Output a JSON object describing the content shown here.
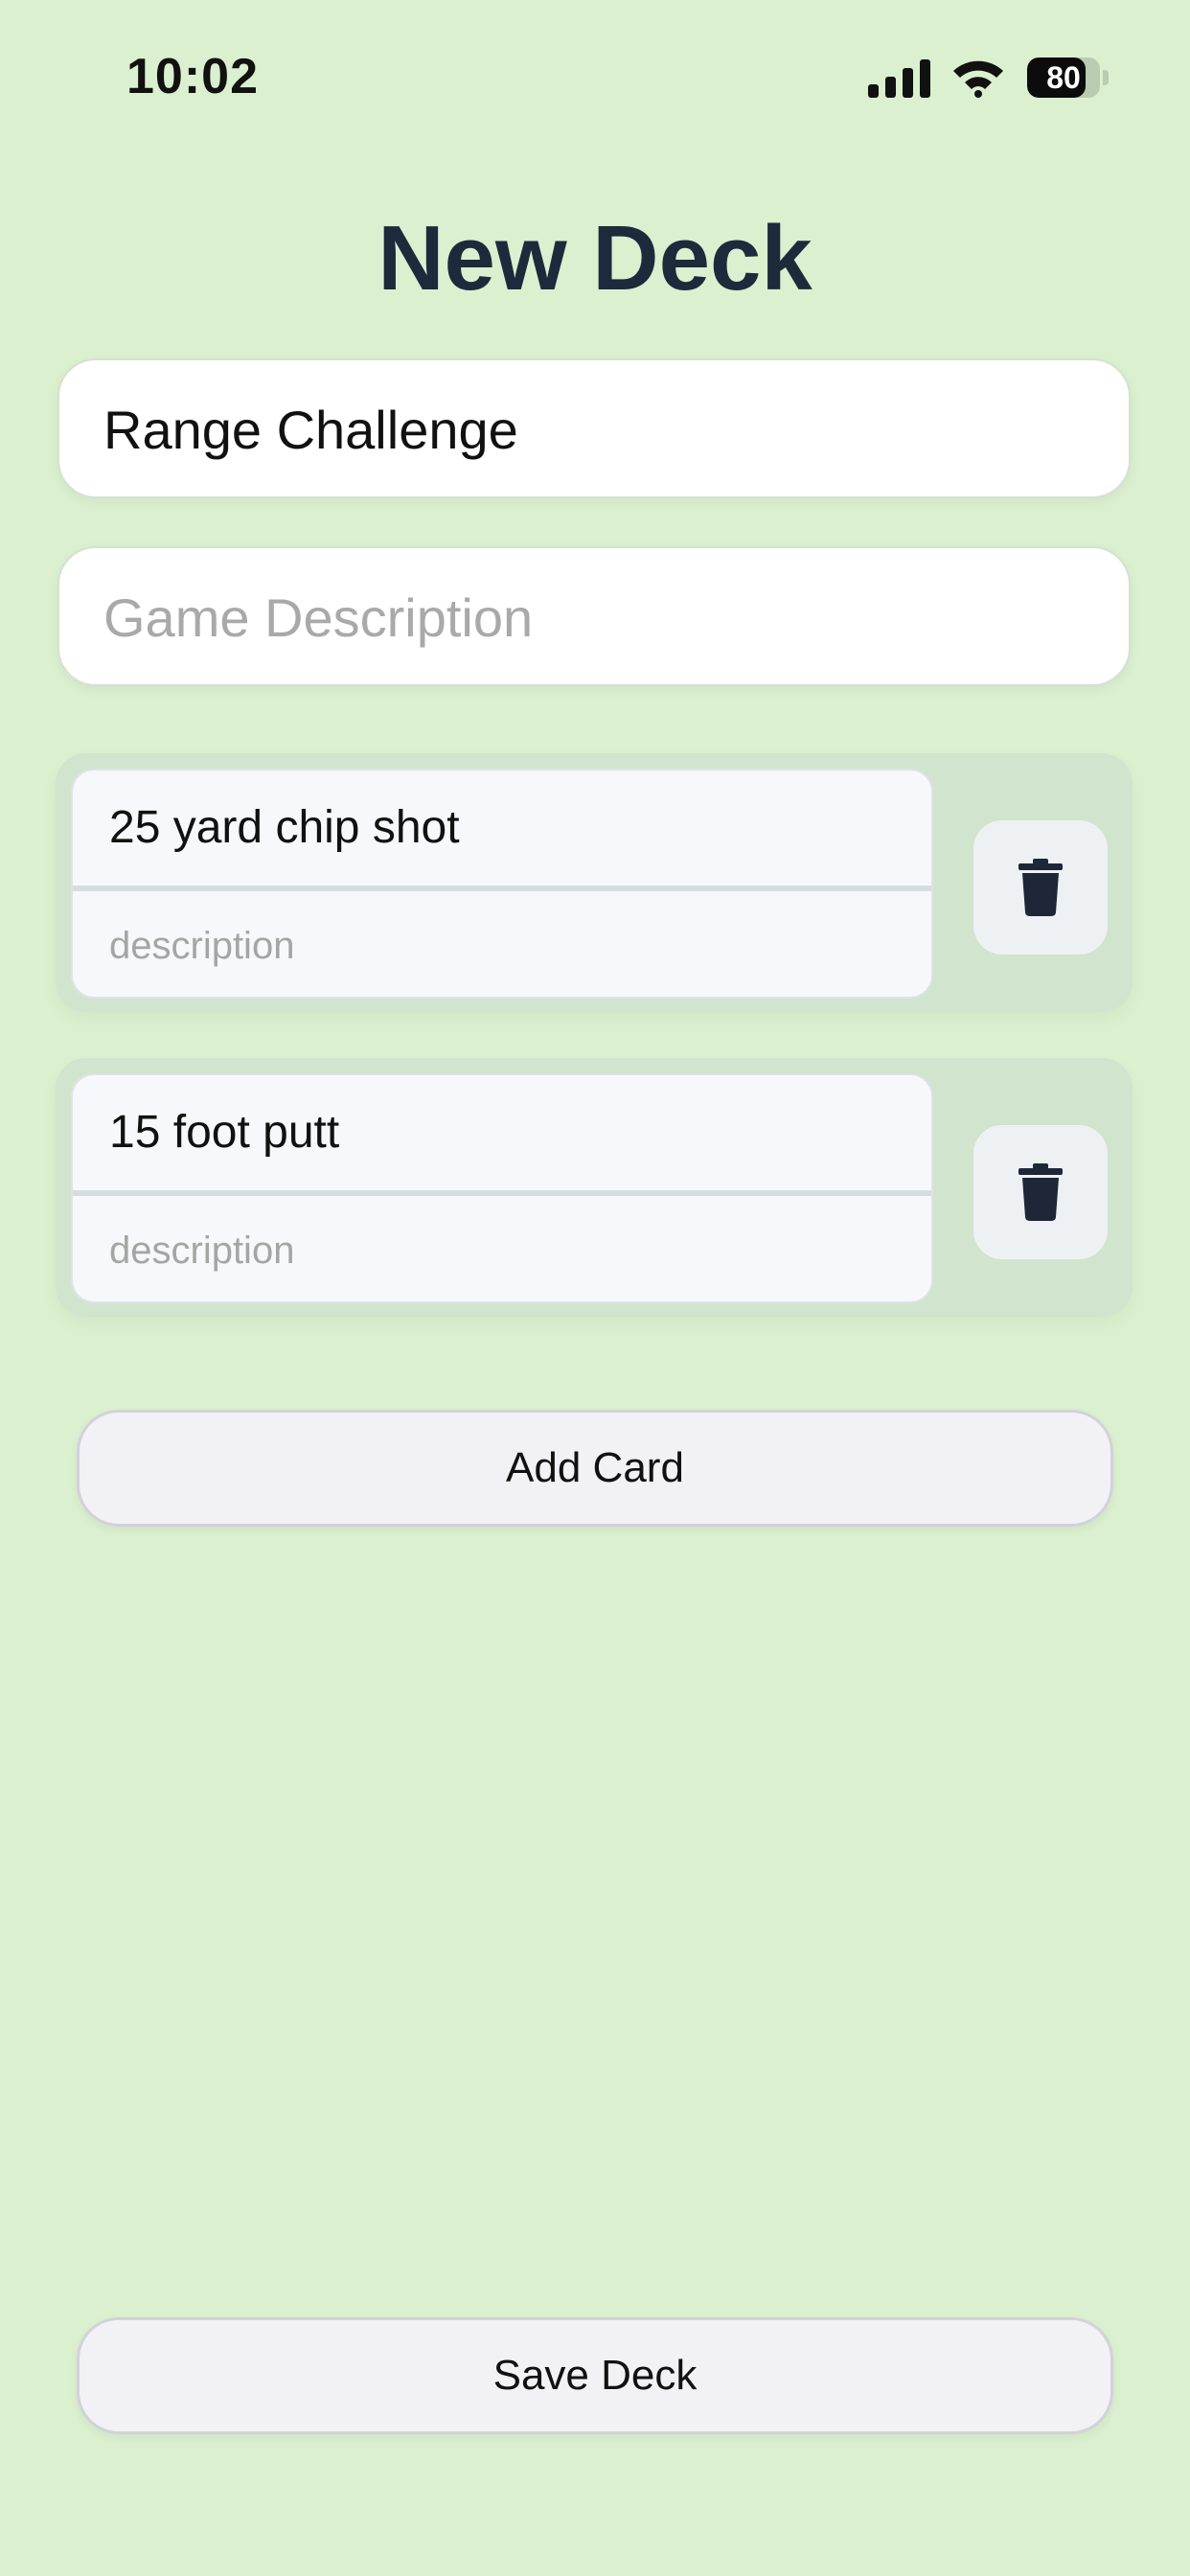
{
  "status_bar": {
    "time": "10:02",
    "battery_level": "80",
    "battery_fraction": 0.8
  },
  "header": {
    "title": "New Deck"
  },
  "form": {
    "name_value": "Range Challenge",
    "description_placeholder": "Game Description"
  },
  "cards": [
    {
      "title": "25 yard chip shot",
      "description_placeholder": "description"
    },
    {
      "title": "15 foot putt",
      "description_placeholder": "description"
    }
  ],
  "actions": {
    "add_card": "Add Card",
    "save_deck": "Save Deck"
  },
  "icons": {
    "signal": "cellular-signal-icon",
    "wifi": "wifi-icon",
    "battery": "battery-icon",
    "delete": "trash-icon"
  },
  "colors": {
    "background": "#daf0cf",
    "title": "#1d2a3b",
    "card_row": "#d1e4cd",
    "button": "#f1f1f6"
  }
}
